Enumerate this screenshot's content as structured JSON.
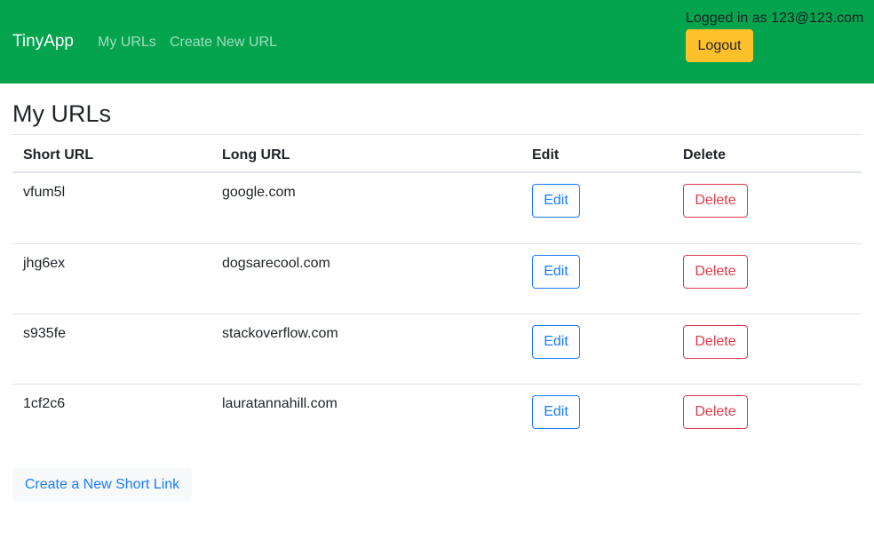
{
  "navbar": {
    "brand": "TinyApp",
    "links": [
      "My URLs",
      "Create New URL"
    ],
    "logged_in_text": "Logged in as 123@123.com",
    "logout_label": "Logout",
    "colors": {
      "background": "#04a44e",
      "logout_button": "#ffc02a"
    }
  },
  "page": {
    "title": "My URLs"
  },
  "table": {
    "headers": [
      "Short URL",
      "Long URL",
      "Edit",
      "Delete"
    ],
    "rows": [
      {
        "short": "vfum5l",
        "long": "google.com",
        "edit_label": "Edit",
        "delete_label": "Delete"
      },
      {
        "short": "jhg6ex",
        "long": "dogsarecool.com",
        "edit_label": "Edit",
        "delete_label": "Delete"
      },
      {
        "short": "s935fe",
        "long": "stackoverflow.com",
        "edit_label": "Edit",
        "delete_label": "Delete"
      },
      {
        "short": "1cf2c6",
        "long": "lauratannahill.com",
        "edit_label": "Edit",
        "delete_label": "Delete"
      }
    ],
    "colors": {
      "edit": "#1a7bff",
      "delete": "#dc3b4a"
    }
  },
  "footer": {
    "create_link_label": "Create a New Short Link"
  }
}
